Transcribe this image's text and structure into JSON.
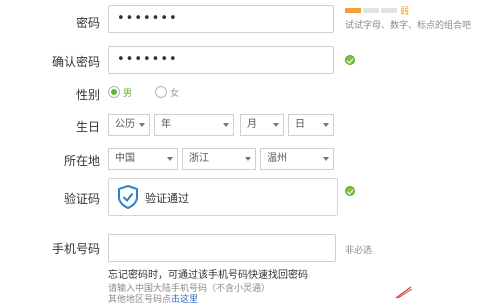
{
  "password": {
    "label": "密码",
    "value": "•••••••",
    "strength_label": "弱",
    "hint": "试试字母、数字、标点的组合吧"
  },
  "confirm_password": {
    "label": "确认密码",
    "value": "•••••••"
  },
  "gender": {
    "label": "性别",
    "options": [
      "男",
      "女"
    ],
    "selected": "男"
  },
  "birthday": {
    "label": "生日",
    "calendar": "公历",
    "year": "年",
    "month": "月",
    "day": "日"
  },
  "location": {
    "label": "所在地",
    "country": "中国",
    "province": "浙江",
    "city": "温州"
  },
  "captcha": {
    "label": "验证码",
    "status": "验证通过"
  },
  "phone": {
    "label": "手机号码",
    "optional": "非必选",
    "tip": "忘记密码时，可通过该手机号码快速找回密码",
    "note1": "请输入中国大陆手机号码（不含小灵通）",
    "note2_prefix": "其他地区号码点",
    "note2_link": "击这里"
  },
  "colors": {
    "accent_green": "#7dc242",
    "strength_orange": "#f0a23a",
    "shield_blue": "#2e7fcf",
    "link_blue": "#2b6bb5"
  }
}
